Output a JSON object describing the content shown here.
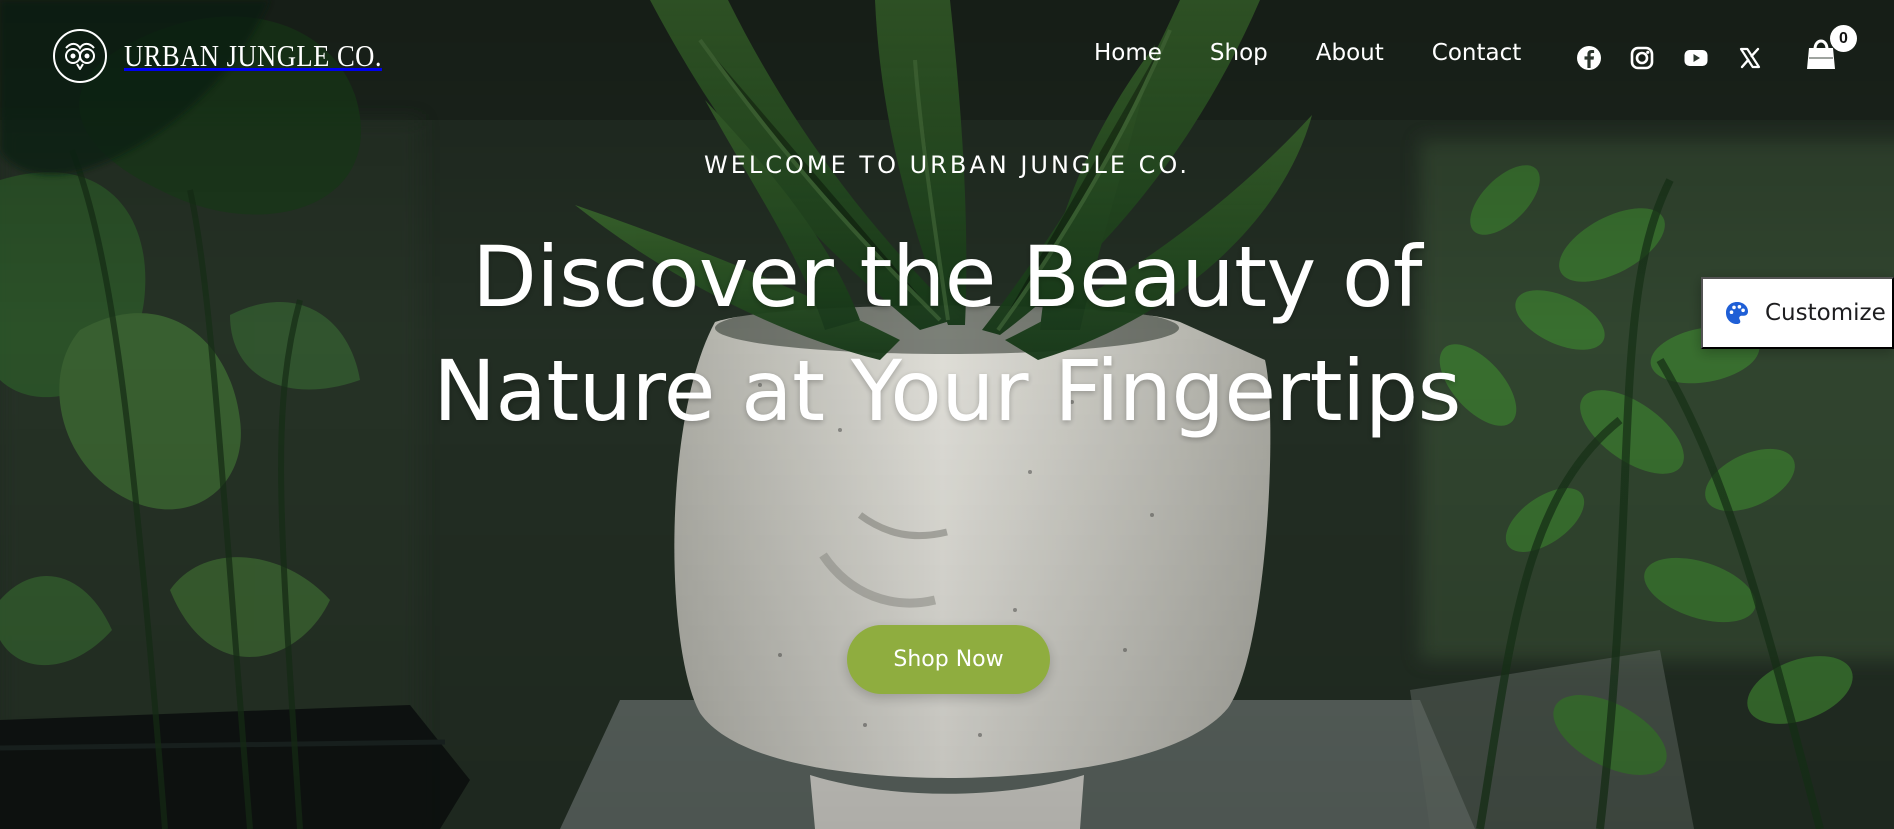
{
  "brand": {
    "name": "URBAN JUNGLE CO."
  },
  "nav": {
    "items": [
      {
        "label": "Home"
      },
      {
        "label": "Shop"
      },
      {
        "label": "About"
      },
      {
        "label": "Contact"
      }
    ]
  },
  "social": {
    "icons": [
      "facebook-icon",
      "instagram-icon",
      "youtube-icon",
      "x-twitter-icon"
    ]
  },
  "cart": {
    "count": "0",
    "icon": "shopping-bag-icon"
  },
  "hero": {
    "eyebrow": "WELCOME TO URBAN JUNGLE CO.",
    "headline": "Discover the Beauty of Nature at Your Fingertips",
    "cta_label": "Shop Now"
  },
  "customize": {
    "label": "Customize",
    "icon": "palette-icon"
  },
  "colors": {
    "accent": "#8fad3f",
    "text": "#ffffff",
    "customize_icon": "#1f5fd6"
  }
}
